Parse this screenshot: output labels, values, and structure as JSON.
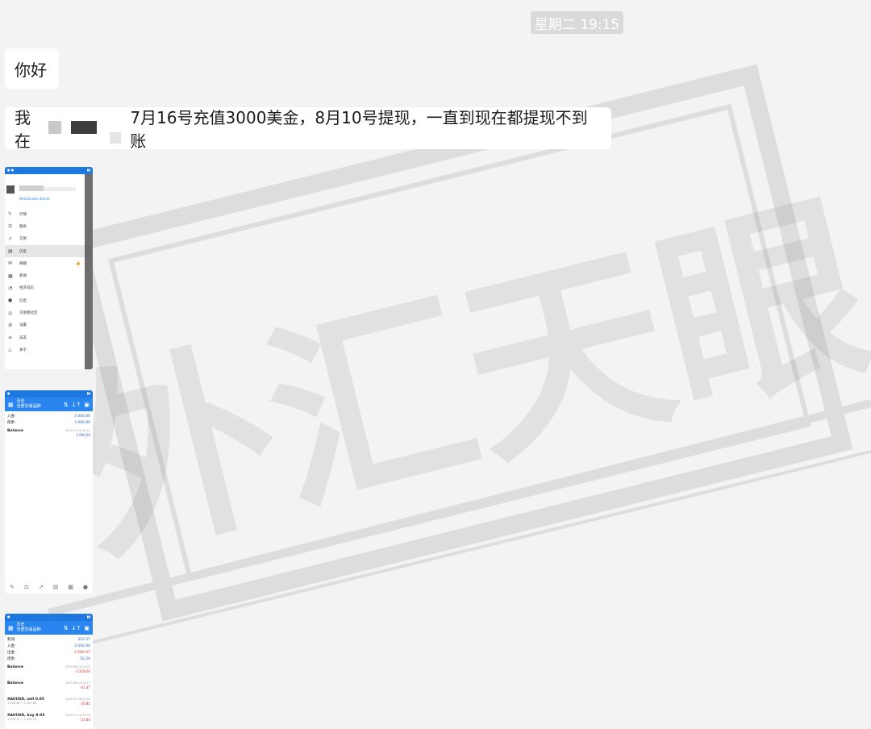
{
  "chat": {
    "timestamp": "星期二 19:15",
    "messages": [
      {
        "text": "你好"
      },
      {
        "prefix": "我在",
        "suffix": "7月16号充值3000美金，8月10号提现，一直到现在都提现不到账"
      }
    ]
  },
  "watermark": {
    "text": "外汇天眼"
  },
  "menu_screen": {
    "profile_sub": "MetaQuotes-Demo",
    "items": [
      {
        "label": "行情",
        "icon": "pencil-icon"
      },
      {
        "label": "图表",
        "icon": "chart-icon"
      },
      {
        "label": "交易",
        "icon": "trade-icon"
      },
      {
        "label": "历史",
        "icon": "history-icon",
        "active": true
      },
      {
        "label": "邮箱",
        "icon": "mail-icon",
        "badge": true
      },
      {
        "label": "新闻",
        "icon": "news-icon"
      },
      {
        "label": "经济日历",
        "icon": "calendar-icon"
      },
      {
        "label": "信息",
        "icon": "chat-icon"
      },
      {
        "label": "交易者社区",
        "icon": "community-icon"
      },
      {
        "label": "设置",
        "icon": "gear-icon"
      },
      {
        "label": "日志",
        "icon": "log-icon"
      },
      {
        "label": "关于",
        "icon": "info-icon"
      }
    ]
  },
  "account_screen": {
    "title": "历史",
    "subtitle": "全部交易品种",
    "rows": [
      {
        "label": "入金:",
        "value": "3 000.00"
      },
      {
        "label": "结余:",
        "value": "3 000.00"
      }
    ],
    "deal": {
      "label": "Balance",
      "time": "2023.07.16 19:23",
      "amount": "3 000.00"
    }
  },
  "history_screen": {
    "title": "历史",
    "subtitle": "全部交易品种",
    "rows": [
      {
        "label": "利润:",
        "value": "312.57"
      },
      {
        "label": "入金:",
        "value": "3 000.00"
      },
      {
        "label": "出金:",
        "value": "-3 260.37",
        "negative": true
      },
      {
        "label": "结余:",
        "value": "52.20"
      }
    ],
    "deals": [
      {
        "label": "Balance",
        "time": "2023.08.10 13:23",
        "amount": "-3 218.00",
        "negative": true
      },
      {
        "label": "Balance",
        "time": "2023.08.10 20:17",
        "amount": "-41.37",
        "negative": true
      },
      {
        "label": "XAUUSD, sell 0.05",
        "sub": "1 933.48 → 1 937.65",
        "time": "2023.07.16 21:06",
        "amount": "-20.85",
        "negative": true
      },
      {
        "label": "XAUUSD, buy 0.03",
        "sub": "1 933.72 → 1 933.31",
        "time": "2023.07.16 20:55",
        "amount": "-21.84",
        "negative": true
      }
    ]
  }
}
